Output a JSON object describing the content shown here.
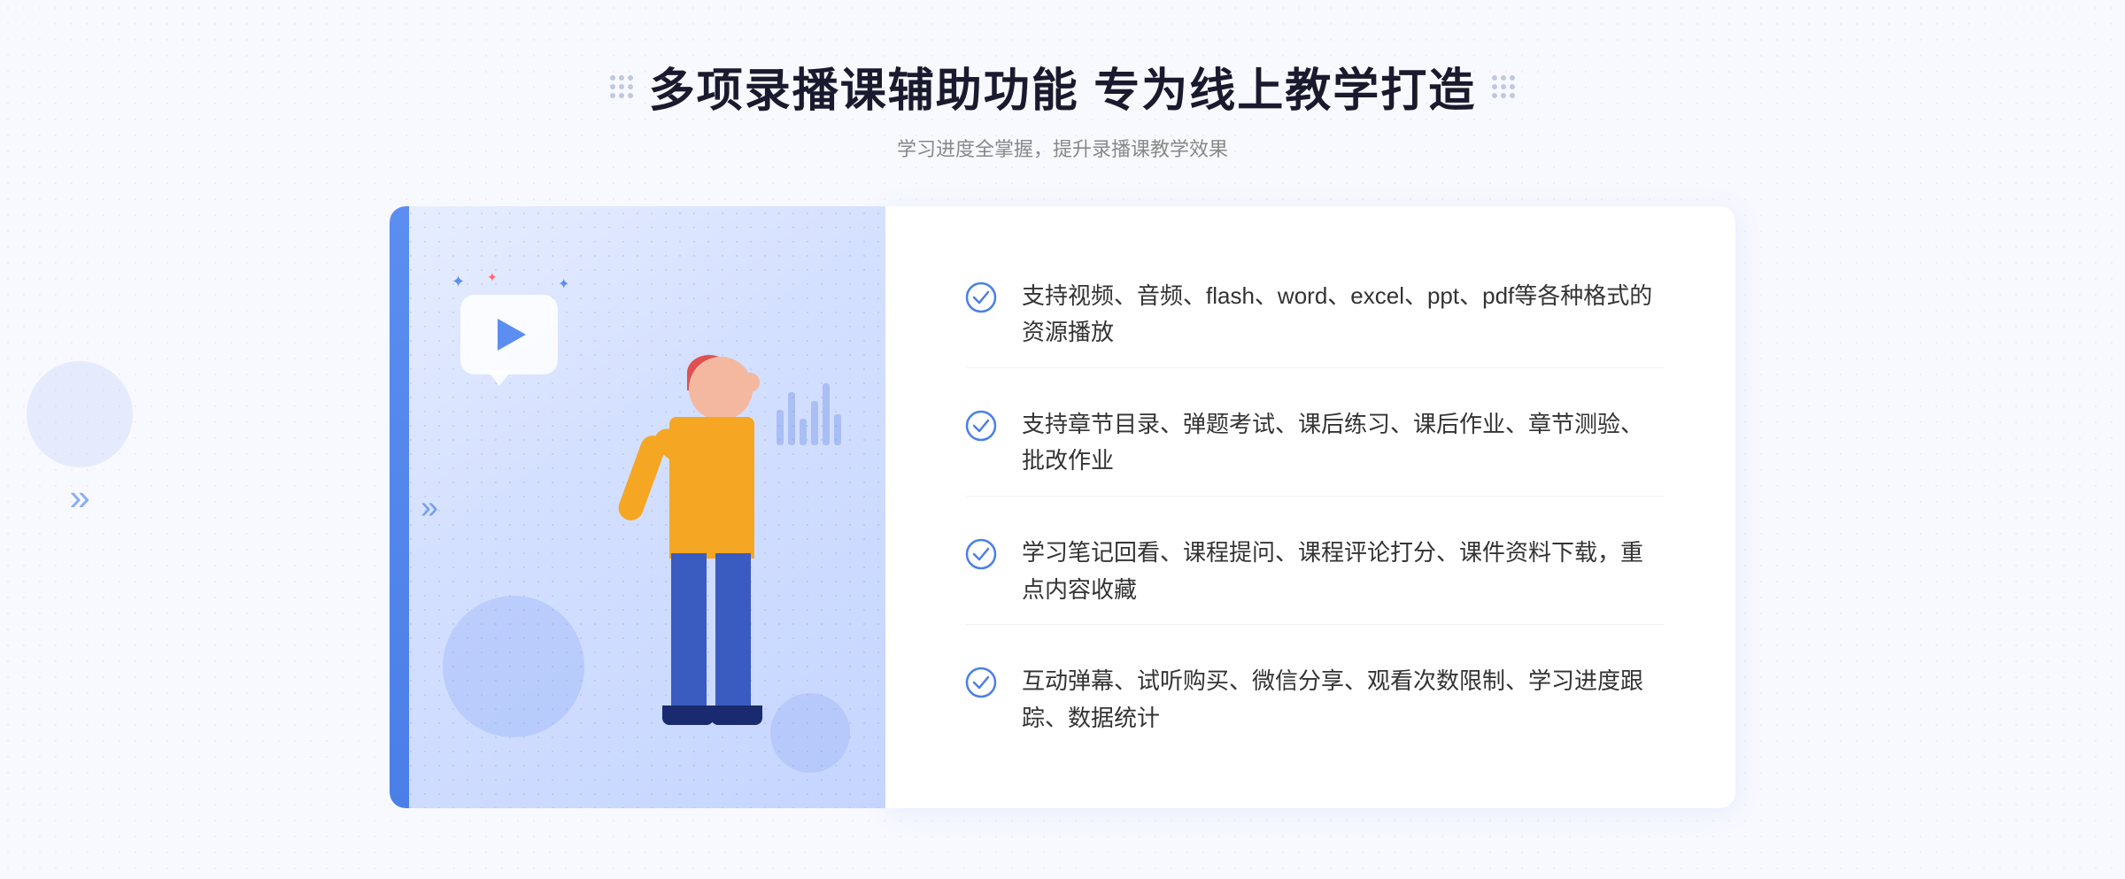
{
  "header": {
    "title": "多项录播课辅助功能 专为线上教学打造",
    "subtitle": "学习进度全掌握，提升录播课教学效果"
  },
  "features": [
    {
      "id": 1,
      "text": "支持视频、音频、flash、word、excel、ppt、pdf等各种格式的资源播放"
    },
    {
      "id": 2,
      "text": "支持章节目录、弹题考试、课后练习、课后作业、章节测验、批改作业"
    },
    {
      "id": 3,
      "text": "学习笔记回看、课程提问、课程评论打分、课件资料下载，重点内容收藏"
    },
    {
      "id": 4,
      "text": "互动弹幕、试听购买、微信分享、观看次数限制、学习进度跟踪、数据统计"
    }
  ],
  "colors": {
    "accent": "#4a7fe8",
    "text_primary": "#1a1a2e",
    "text_secondary": "#888888",
    "check_color": "#4a7fe8"
  }
}
